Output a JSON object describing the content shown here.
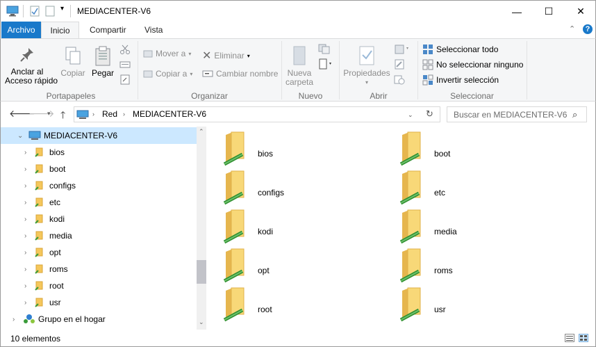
{
  "window": {
    "title": "MEDIACENTER-V6",
    "minimize": "—",
    "maximize": "☐",
    "close": "✕"
  },
  "ribbon_tabs": {
    "file": "Archivo",
    "home": "Inicio",
    "share": "Compartir",
    "view": "Vista",
    "help": "?"
  },
  "ribbon": {
    "pin": "Anclar al\nAcceso rápido",
    "copy": "Copiar",
    "paste": "Pegar",
    "move_to": "Mover a",
    "copy_to": "Copiar a",
    "delete": "Eliminar",
    "rename": "Cambiar nombre",
    "new_folder": "Nueva\ncarpeta",
    "properties": "Propiedades",
    "select_all": "Seleccionar todo",
    "select_none": "No seleccionar ninguno",
    "invert_selection": "Invertir selección",
    "groups": {
      "clipboard": "Portapapeles",
      "organize": "Organizar",
      "new": "Nuevo",
      "open": "Abrir",
      "select": "Seleccionar"
    }
  },
  "address": {
    "crumbs": [
      "Red",
      "MEDIACENTER-V6"
    ],
    "search_placeholder": "Buscar en MEDIACENTER-V6"
  },
  "nav_pane": {
    "root": "MEDIACENTER-V6",
    "items": [
      "bios",
      "boot",
      "configs",
      "etc",
      "kodi",
      "media",
      "opt",
      "roms",
      "root",
      "usr"
    ],
    "homegroup": "Grupo en el hogar"
  },
  "content": {
    "items": [
      "bios",
      "boot",
      "configs",
      "etc",
      "kodi",
      "media",
      "opt",
      "roms",
      "root",
      "usr"
    ]
  },
  "status": {
    "count": "10 elementos"
  },
  "colors": {
    "accent": "#1979ca",
    "selection": "#cce8ff",
    "folder": "#f5c75b",
    "share_pipe": "#3a9b3a"
  }
}
